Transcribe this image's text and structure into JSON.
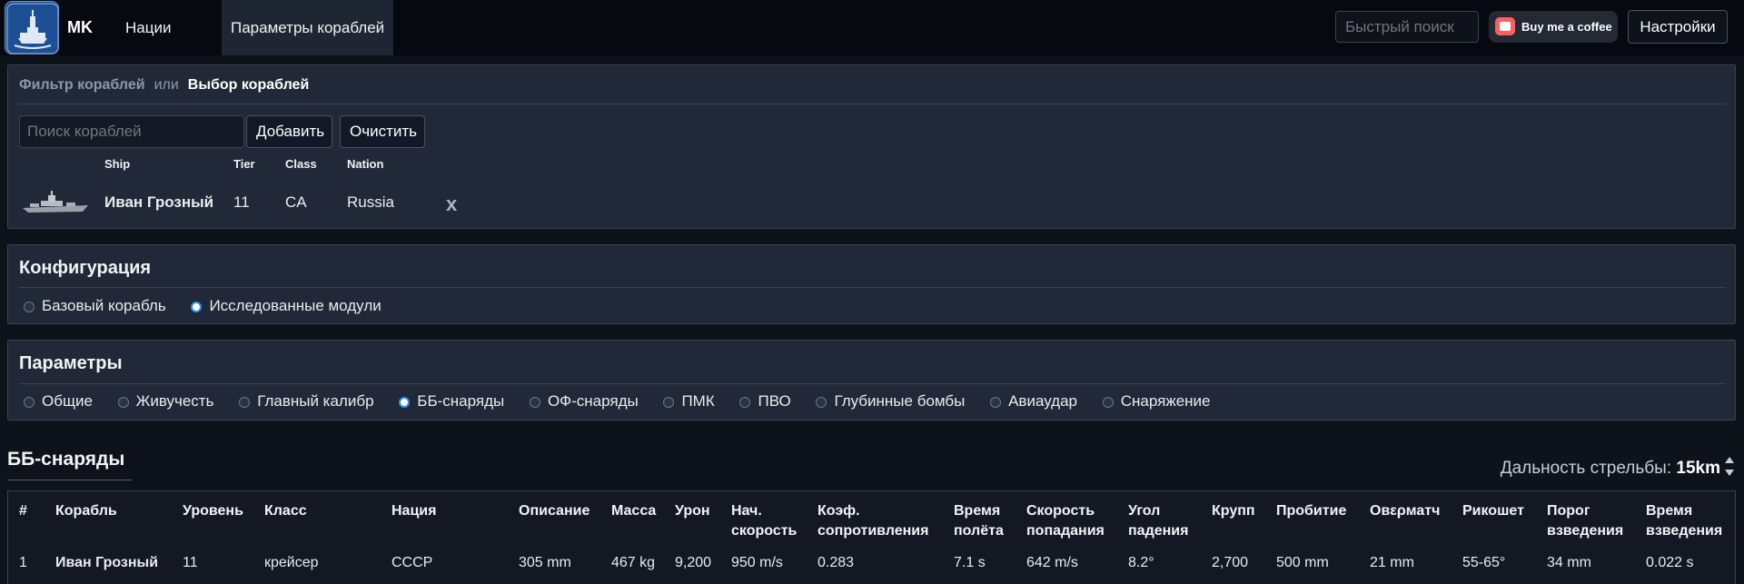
{
  "navbar": {
    "brand": "MK",
    "links": [
      "Нации",
      "Параметры кораблей"
    ],
    "quick_search_placeholder": "Быстрый поиск",
    "coffee_label": "Buy me a coffee",
    "settings_label": "Настройки"
  },
  "filter": {
    "tab_filter": "Фильтр кораблей",
    "or": "или",
    "tab_select": "Выбор кораблей",
    "search_placeholder": "Поиск кораблей",
    "add_label": "Добавить",
    "clear_label": "Очистить",
    "headers": [
      "Ship",
      "Tier",
      "Class",
      "Nation"
    ],
    "ship": {
      "name": "Иван Грозный",
      "tier": "11",
      "class": "CA",
      "nation": "Russia"
    },
    "remove_label": "x"
  },
  "config": {
    "title": "Конфигурация",
    "options": [
      "Базовый корабль",
      "Исследованные модули"
    ],
    "selected": 1
  },
  "params": {
    "title": "Параметры",
    "options": [
      "Общие",
      "Живучесть",
      "Главный калибр",
      "ББ-снаряды",
      "ОФ-снаряды",
      "ПМК",
      "ПВО",
      "Глубинные бомбы",
      "Авиаудар",
      "Снаряжение"
    ],
    "selected": 3
  },
  "section": {
    "title": "ББ-снаряды",
    "range_label": "Дальность стрельбы:",
    "range_value": "15km"
  },
  "table": {
    "headers": [
      [
        "#"
      ],
      [
        "Корабль"
      ],
      [
        "Уровень"
      ],
      [
        "Класс"
      ],
      [
        "Нация"
      ],
      [
        "Описание"
      ],
      [
        "Масса"
      ],
      [
        "Урон"
      ],
      [
        "Нач.",
        "скорость"
      ],
      [
        "Коэф.",
        "сопротивления"
      ],
      [
        "Время",
        "полёта"
      ],
      [
        "Скорость",
        "попадания"
      ],
      [
        "Угол",
        "падения"
      ],
      [
        "Крупп"
      ],
      [
        "Пробитие"
      ],
      [
        "Овερматч"
      ],
      [
        "Рикошет"
      ],
      [
        "Порог",
        "взведения"
      ],
      [
        "Время",
        "взведения"
      ]
    ],
    "rows": [
      [
        "1",
        "Иван Грозный",
        "11",
        "крейсер",
        "СССР",
        "305 mm",
        "467 kg",
        "9,200",
        "950 m/s",
        "0.283",
        "7.1 s",
        "642 m/s",
        "8.2°",
        "2,700",
        "500 mm",
        "21 mm",
        "55-65°",
        "34 mm",
        "0.022 s"
      ]
    ]
  }
}
